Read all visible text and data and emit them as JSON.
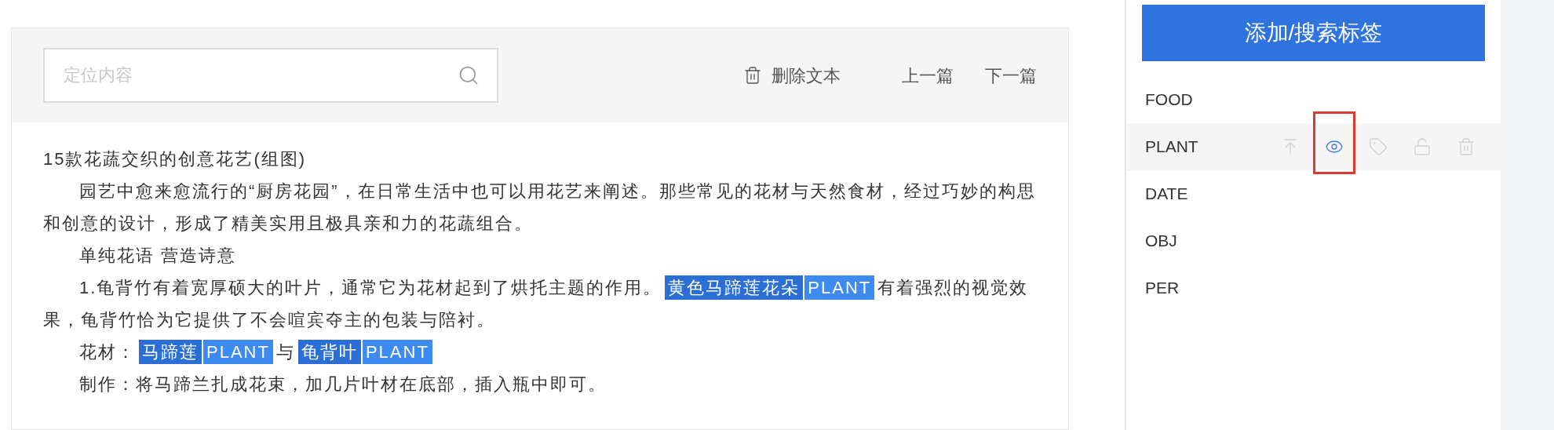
{
  "toolbar": {
    "search": {
      "placeholder": "定位内容"
    },
    "delete_label": "删除文本",
    "prev_label": "上一篇",
    "next_label": "下一篇"
  },
  "document": {
    "paragraphs": [
      {
        "indent": false,
        "segments": [
          {
            "kind": "text",
            "text": "15款花蔬交织的创意花艺(组图)"
          }
        ]
      },
      {
        "indent": true,
        "segments": [
          {
            "kind": "text",
            "text": "园艺中愈来愈流行的“厨房花园”，在日常生活中也可以用花艺来阐述。那些常见的花材与天然食材，经过巧妙的构思和创意的设计，形成了精美实用且极具亲和力的花蔬组合。"
          }
        ]
      },
      {
        "indent": true,
        "segments": [
          {
            "kind": "text",
            "text": "单纯花语 营造诗意"
          }
        ]
      },
      {
        "indent": true,
        "segments": [
          {
            "kind": "text",
            "text": "1.龟背竹有着宽厚硕大的叶片，通常它为花材起到了烘托主题的作用。"
          },
          {
            "kind": "entity",
            "text": "黄色马蹄莲花朵",
            "label": "PLANT"
          },
          {
            "kind": "text",
            "text": "有着强烈的视觉效"
          },
          {
            "kind": "text",
            "text": "果，龟背竹恰为它提供了不会喧宾夺主的包装与陪衬。"
          }
        ]
      },
      {
        "indent": true,
        "segments": [
          {
            "kind": "text",
            "text": "花材："
          },
          {
            "kind": "entity",
            "text": "马蹄莲",
            "label": "PLANT"
          },
          {
            "kind": "text",
            "text": "与"
          },
          {
            "kind": "entity",
            "text": "龟背叶",
            "label": "PLANT"
          }
        ]
      },
      {
        "indent": true,
        "segments": [
          {
            "kind": "text",
            "text": "制作：将马蹄兰扎成花束，加几片叶材在底部，插入瓶中即可。"
          }
        ]
      }
    ]
  },
  "tag_panel": {
    "add_button": "添加/搜索标签",
    "tags": [
      {
        "name": "FOOD",
        "selected": false
      },
      {
        "name": "PLANT",
        "selected": true
      },
      {
        "name": "DATE",
        "selected": false
      },
      {
        "name": "OBJ",
        "selected": false
      },
      {
        "name": "PER",
        "selected": false
      }
    ],
    "actions": [
      {
        "kind": "pin-top",
        "active": false
      },
      {
        "kind": "visibility",
        "active": true,
        "highlighted": true
      },
      {
        "kind": "tag",
        "active": false
      },
      {
        "kind": "lock",
        "active": false
      },
      {
        "kind": "delete",
        "active": false
      }
    ]
  }
}
